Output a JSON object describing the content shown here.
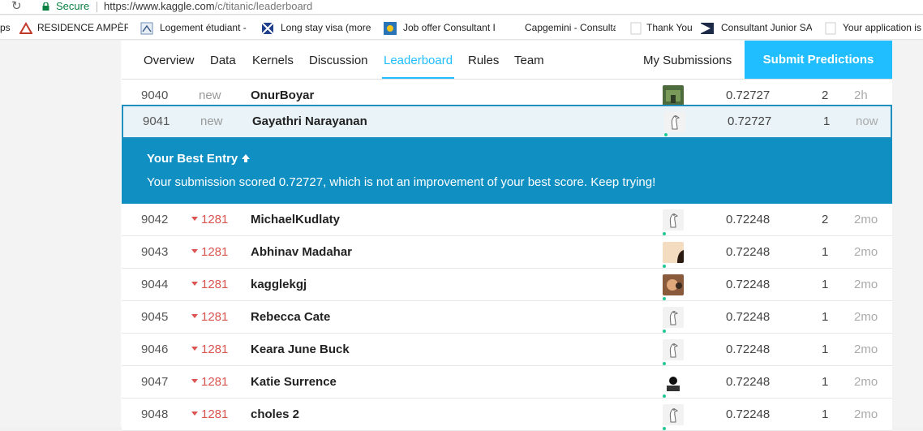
{
  "browser": {
    "secure_label": "Secure",
    "url_host": "https://www.kaggle.com",
    "url_path": "/c/titanic/leaderboard"
  },
  "bookmarks": [
    {
      "label": "ps"
    },
    {
      "label": "RESIDENCE AMPÈRE |"
    },
    {
      "label": "Logement étudiant -"
    },
    {
      "label": "Long stay visa (more"
    },
    {
      "label": "Job offer Consultant I"
    },
    {
      "label": "Capgemini - Consulta"
    },
    {
      "label": "Thank You"
    },
    {
      "label": "Consultant Junior SAI"
    },
    {
      "label": "Your application is"
    }
  ],
  "nav": {
    "tabs": [
      {
        "label": "Overview"
      },
      {
        "label": "Data"
      },
      {
        "label": "Kernels"
      },
      {
        "label": "Discussion"
      },
      {
        "label": "Leaderboard"
      },
      {
        "label": "Rules"
      },
      {
        "label": "Team"
      }
    ],
    "active_tab": "Leaderboard",
    "my_submissions": "My Submissions",
    "submit_label": "Submit Predictions"
  },
  "rows": [
    {
      "rank": "9040",
      "change": "new",
      "change_dir": "new",
      "name": "OnurBoyar",
      "score": "0.72727",
      "entries": "2",
      "last": "2h",
      "avatar": "photo-green"
    },
    {
      "rank": "9041",
      "change": "new",
      "change_dir": "new",
      "name": "Gayathri Narayanan",
      "score": "0.72727",
      "entries": "1",
      "last": "now",
      "avatar": "goose"
    },
    {
      "rank": "9042",
      "change": "1281",
      "change_dir": "down",
      "name": "MichaelKudlaty",
      "score": "0.72248",
      "entries": "2",
      "last": "2mo",
      "avatar": "goose"
    },
    {
      "rank": "9043",
      "change": "1281",
      "change_dir": "down",
      "name": "Abhinav Madahar",
      "score": "0.72248",
      "entries": "1",
      "last": "2mo",
      "avatar": "photo-skin"
    },
    {
      "rank": "9044",
      "change": "1281",
      "change_dir": "down",
      "name": "kagglekgj",
      "score": "0.72248",
      "entries": "1",
      "last": "2mo",
      "avatar": "photo-face"
    },
    {
      "rank": "9045",
      "change": "1281",
      "change_dir": "down",
      "name": "Rebecca Cate",
      "score": "0.72248",
      "entries": "1",
      "last": "2mo",
      "avatar": "goose"
    },
    {
      "rank": "9046",
      "change": "1281",
      "change_dir": "down",
      "name": "Keara June Buck",
      "score": "0.72248",
      "entries": "1",
      "last": "2mo",
      "avatar": "goose"
    },
    {
      "rank": "9047",
      "change": "1281",
      "change_dir": "down",
      "name": "Katie Surrence",
      "score": "0.72248",
      "entries": "1",
      "last": "2mo",
      "avatar": "photo-bw"
    },
    {
      "rank": "9048",
      "change": "1281",
      "change_dir": "down",
      "name": "choles 2",
      "score": "0.72248",
      "entries": "1",
      "last": "2mo",
      "avatar": "goose"
    }
  ],
  "best_entry": {
    "heading": "Your Best Entry",
    "message": "Your submission scored 0.72727, which is not an improvement of your best score. Keep trying!"
  },
  "colors": {
    "accent": "#20beff",
    "banner": "#0f8fc2",
    "down": "#d9534f"
  }
}
